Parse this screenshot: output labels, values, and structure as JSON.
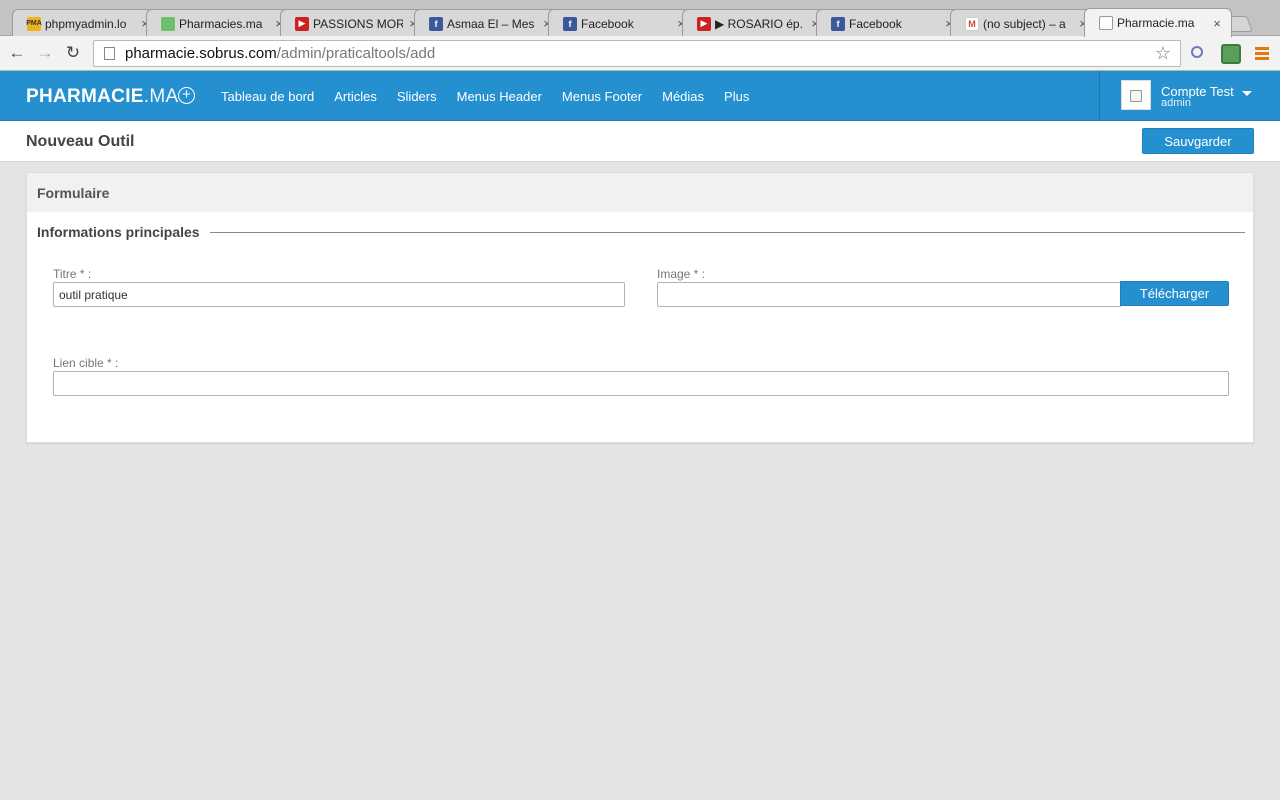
{
  "browser": {
    "tabs": [
      {
        "title": "phpmyadmin.lo",
        "favicon": "pma-icon"
      },
      {
        "title": "Pharmacies.ma",
        "favicon": "leaf-icon"
      },
      {
        "title": "PASSIONS MOR",
        "favicon": "youtube-icon"
      },
      {
        "title": "Asmaa El – Mes",
        "favicon": "facebook-icon"
      },
      {
        "title": "Facebook",
        "favicon": "facebook-icon"
      },
      {
        "title": "▶ ROSARIO ép.",
        "favicon": "youtube-icon"
      },
      {
        "title": "Facebook",
        "favicon": "facebook-icon"
      },
      {
        "title": "(no subject) – a",
        "favicon": "gmail-icon"
      },
      {
        "title": "Pharmacie.ma",
        "favicon": "page-icon"
      }
    ],
    "url_host": "pharmacie.sobrus.com",
    "url_path": "/admin/praticaltools/add"
  },
  "app": {
    "brand_bold": "PHARMACIE",
    "brand_light": ".MA",
    "nav": [
      "Tableau de bord",
      "Articles",
      "Sliders",
      "Menus Header",
      "Menus Footer",
      "Médias",
      "Plus"
    ],
    "account_name": "Compte Test",
    "account_role": "admin"
  },
  "page": {
    "title": "Nouveau Outil",
    "save_label": "Sauvgarder"
  },
  "form": {
    "card_title": "Formulaire",
    "section_title": "Informations principales",
    "titre_label": "Titre * :",
    "titre_value": "outil pratique",
    "image_label": "Image * :",
    "image_value": "",
    "upload_label": "Télécharger",
    "lien_label": "Lien cible * :",
    "lien_value": ""
  },
  "colors": {
    "brand_blue": "#2590d0",
    "page_bg": "#e4e4e4"
  }
}
